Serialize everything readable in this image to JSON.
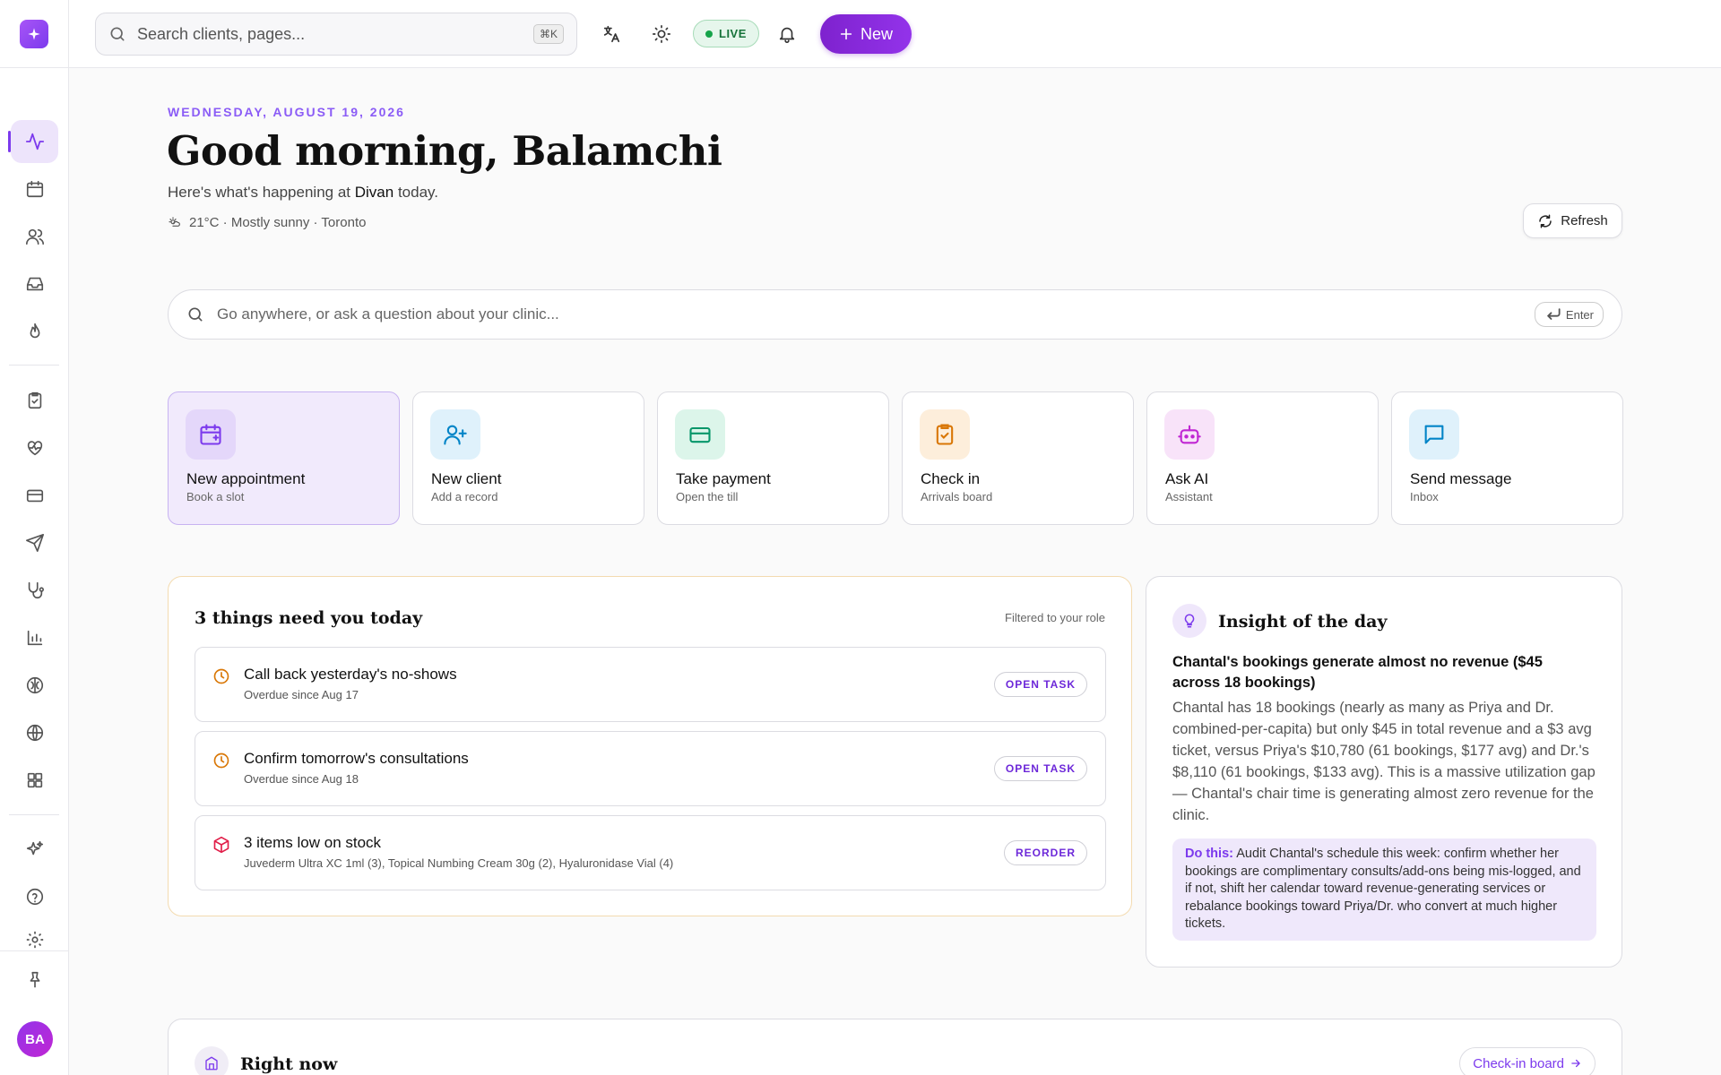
{
  "topbar": {
    "search_placeholder": "Search clients, pages...",
    "search_shortcut": "⌘K",
    "live_label": "LIVE",
    "new_label": "New"
  },
  "header": {
    "date": "WEDNESDAY, AUGUST 19, 2026",
    "greeting": "Good morning, Balamchi",
    "sub_prefix": "Here's what's happening at",
    "clinic": "Divan",
    "sub_suffix": "today.",
    "weather": "21°C · Mostly sunny · Toronto",
    "refresh_label": "Refresh"
  },
  "ask": {
    "placeholder": "Go anywhere, or ask a question about your clinic...",
    "enter_label": "Enter"
  },
  "actions": [
    {
      "title": "New appointment",
      "subtitle": "Book a slot",
      "icon": "calendar-plus-icon",
      "color": "#7c3aed",
      "bg": "#e4d7fa"
    },
    {
      "title": "New client",
      "subtitle": "Add a record",
      "icon": "user-plus-icon",
      "color": "#0284c7",
      "bg": "#dff1fb"
    },
    {
      "title": "Take payment",
      "subtitle": "Open the till",
      "icon": "credit-card-icon",
      "color": "#059669",
      "bg": "#dcf5ea"
    },
    {
      "title": "Check in",
      "subtitle": "Arrivals board",
      "icon": "clipboard-check-icon",
      "color": "#d97706",
      "bg": "#fdeedb"
    },
    {
      "title": "Ask AI",
      "subtitle": "Assistant",
      "icon": "bot-icon",
      "color": "#c026d3",
      "bg": "#f8e3f9"
    },
    {
      "title": "Send message",
      "subtitle": "Inbox",
      "icon": "message-icon",
      "color": "#0284c7",
      "bg": "#dff1fb"
    }
  ],
  "tasks": {
    "title": "3 things need you today",
    "filter": "Filtered to your role",
    "items": [
      {
        "title": "Call back yesterday's no-shows",
        "subtitle": "Overdue since Aug 17",
        "action": "OPEN TASK",
        "icon": "clock-icon",
        "color": "#d97706"
      },
      {
        "title": "Confirm tomorrow's consultations",
        "subtitle": "Overdue since Aug 18",
        "action": "OPEN TASK",
        "icon": "clock-icon",
        "color": "#d97706"
      },
      {
        "title": "3 items low on stock",
        "subtitle": "Juvederm Ultra XC 1ml (3), Topical Numbing Cream 30g (2), Hyaluronidase Vial (4)",
        "action": "REORDER",
        "icon": "package-icon",
        "color": "#e11d48"
      }
    ]
  },
  "insight": {
    "title": "Insight of the day",
    "headline": "Chantal's bookings generate almost no revenue ($45 across 18 bookings)",
    "body": "Chantal has 18 bookings (nearly as many as Priya and Dr. combined-per-capita) but only $45 in total revenue and a $3 avg ticket, versus Priya's $10,780 (61 bookings, $177 avg) and Dr.'s $8,110 (61 bookings, $133 avg). This is a massive utilization gap — Chantal's chair time is generating almost zero revenue for the clinic.",
    "do_label": "Do this:",
    "do_text": "Audit Chantal's schedule this week: confirm whether her bookings are complimentary consults/add-ons being mis-logged, and if not, shift her calendar toward revenue-generating services or rebalance bookings toward Priya/Dr. who convert at much higher tickets."
  },
  "right_now": {
    "title": "Right now",
    "button": "Check-in board"
  },
  "user": {
    "initials": "BA"
  },
  "colors": {
    "accent": "#7c3aed",
    "live": "#16a34a"
  }
}
